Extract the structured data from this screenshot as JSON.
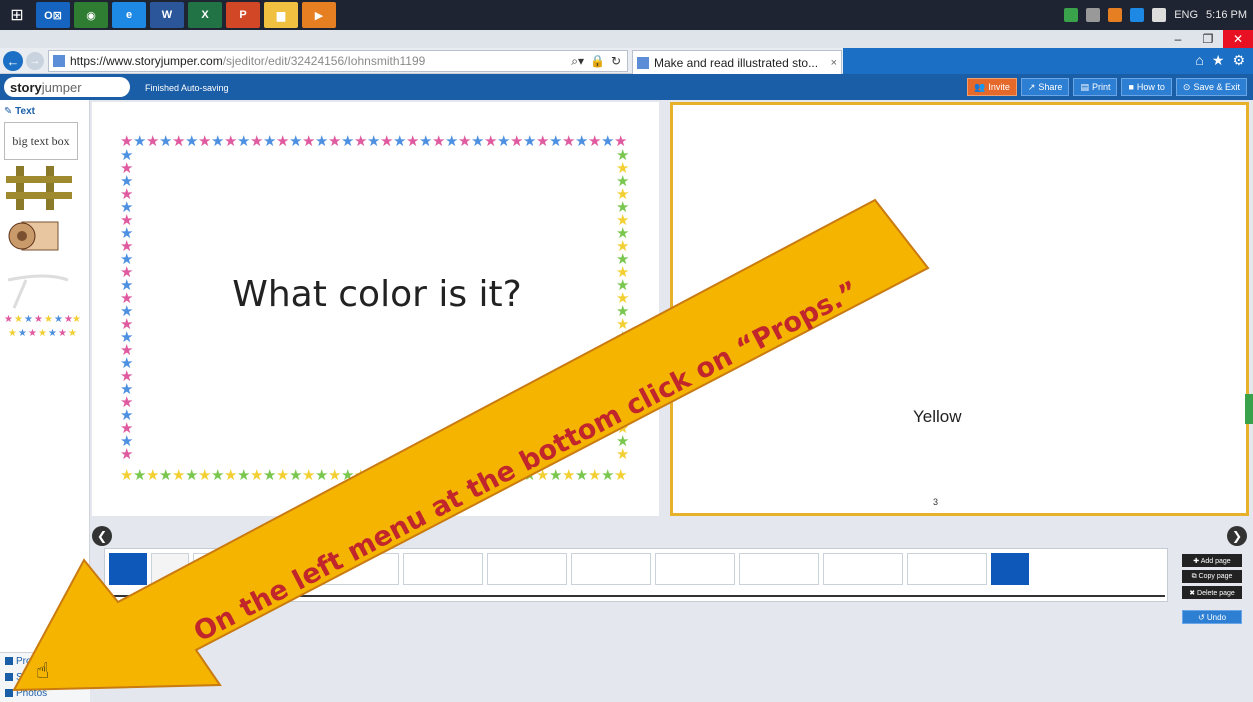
{
  "taskbar": {
    "apps": [
      {
        "icon": "windows-start-icon",
        "label": "⊞",
        "color": "#1f2433"
      },
      {
        "icon": "outlook-icon",
        "label": "O⊠",
        "color": "#1565c0"
      },
      {
        "icon": "chrome-icon",
        "label": "◉",
        "color": "#2e7d32"
      },
      {
        "icon": "ie-icon",
        "label": "e",
        "color": "#1e88e5"
      },
      {
        "icon": "word-icon",
        "label": "W",
        "color": "#2b579a"
      },
      {
        "icon": "excel-icon",
        "label": "X",
        "color": "#217346"
      },
      {
        "icon": "powerpoint-icon",
        "label": "P",
        "color": "#d24726"
      },
      {
        "icon": "explorer-icon",
        "label": "▆",
        "color": "#f0c040"
      },
      {
        "icon": "media-player-icon",
        "label": "▶",
        "color": "#e67e22"
      }
    ],
    "lang": "ENG",
    "time": "5:16 PM"
  },
  "browser": {
    "url_prefix": "https://www.",
    "url_domain": "storyjumper.com",
    "url_path": "/sjeditor/edit/32424156/Iohnsmith1199",
    "tab_title": "Make and read illustrated sto...",
    "tab_close": "×"
  },
  "sj": {
    "logo_bold": "story",
    "logo_light": "jumper",
    "status": "Finished Auto-saving",
    "buttons": [
      {
        "name": "invite-button",
        "label": "Invite",
        "icon": "👥"
      },
      {
        "name": "share-button",
        "label": "Share",
        "icon": "↗"
      },
      {
        "name": "print-button",
        "label": "Print",
        "icon": "▤"
      },
      {
        "name": "howto-button",
        "label": "How to",
        "icon": "■"
      },
      {
        "name": "save-exit-button",
        "label": "Save & Exit",
        "icon": "⊙"
      }
    ]
  },
  "left_panel": {
    "text_label": "✎ Text",
    "textbox_sample": "big text box",
    "bottom_items": [
      {
        "name": "props-menu-item",
        "label": "Props"
      },
      {
        "name": "scenes-menu-item",
        "label": "Scenes"
      },
      {
        "name": "photos-menu-item",
        "label": "Photos"
      }
    ]
  },
  "pages": {
    "left_text": "What color is it?",
    "right_text": "Yellow",
    "right_page_number": "3"
  },
  "page_tools": {
    "add_page": "✚ Add page",
    "copy_page": "⧉ Copy page",
    "delete_page": "✖ Delete page",
    "undo": "↺ Undo"
  },
  "annotation": {
    "text": "On the left menu at the bottom click on “Props.”",
    "fill": "#f5b400",
    "text_color": "#c0262c"
  }
}
